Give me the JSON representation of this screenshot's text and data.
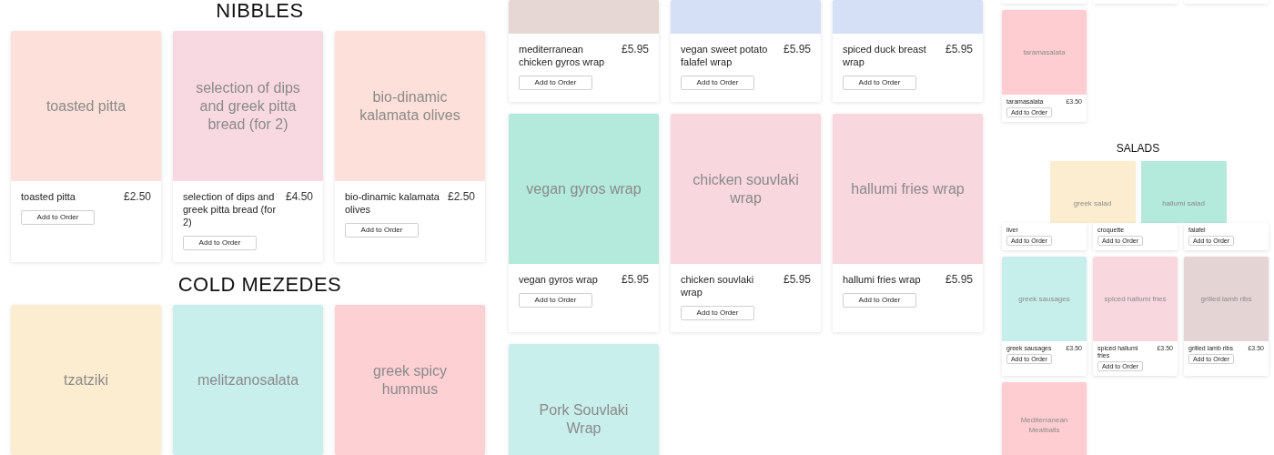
{
  "columns": [
    {
      "blocks": [
        {
          "kind": "heading",
          "text": "NIBBLES"
        },
        {
          "kind": "grid",
          "cards": [
            {
              "kind": "full",
              "color": "#fde0da",
              "image_label": "toasted pitta",
              "name": "toasted pitta",
              "price": "£2.50",
              "button": "Add to Order"
            },
            {
              "kind": "full",
              "color": "#f9d9e1",
              "image_label": "selection of dips and greek pitta bread (for 2)",
              "name": "selection of dips and greek pitta bread (for 2)",
              "price": "£4.50",
              "button": "Add to Order"
            },
            {
              "kind": "full",
              "color": "#fde0da",
              "image_label": "bio-dinamic kalamata olives",
              "name": "bio-dinamic kalamata olives",
              "price": "£2.50",
              "button": "Add to Order"
            }
          ]
        },
        {
          "kind": "heading",
          "text": "COLD MEZEDES"
        },
        {
          "kind": "grid",
          "cards": [
            {
              "kind": "image_only",
              "color": "#fdedd0",
              "image_label": "tzatziki"
            },
            {
              "kind": "image_only",
              "color": "#c8efec",
              "image_label": "melitzanosalata"
            },
            {
              "kind": "image_only",
              "color": "#fdd0d4",
              "image_label": "greek spicy hummus"
            }
          ]
        }
      ]
    },
    {
      "blocks": [
        {
          "kind": "grid",
          "cards": [
            {
              "kind": "cropped_top",
              "color": "#e6d6d4",
              "name": "mediterranean chicken gyros wrap",
              "price": "£5.95",
              "button": "Add to Order"
            },
            {
              "kind": "cropped_top",
              "color": "#d5e0f6",
              "name": "vegan sweet potato falafel wrap",
              "price": "£5.95",
              "button": "Add to Order"
            },
            {
              "kind": "cropped_top",
              "color": "#d5e0f6",
              "name": "spiced duck breast wrap",
              "price": "£5.95",
              "button": "Add to Order"
            }
          ]
        },
        {
          "kind": "grid",
          "cards": [
            {
              "kind": "full",
              "color": "#b4eadb",
              "image_label": "vegan gyros wrap",
              "name": "vegan gyros wrap",
              "price": "£5.95",
              "button": "Add to Order"
            },
            {
              "kind": "full",
              "color": "#f8d7df",
              "image_label": "chicken souvlaki wrap",
              "name": "chicken souvlaki wrap",
              "price": "£5.95",
              "button": "Add to Order"
            },
            {
              "kind": "full",
              "color": "#f8d7df",
              "image_label": "hallumi fries wrap",
              "name": "hallumi fries wrap",
              "price": "£5.95",
              "button": "Add to Order"
            }
          ]
        },
        {
          "kind": "grid",
          "cards": [
            {
              "kind": "image_only",
              "color": "#c8efec",
              "image_label": "Pork Souvlaki Wrap"
            }
          ]
        }
      ]
    },
    {
      "blocks": [
        {
          "kind": "grid",
          "cards": [
            {
              "kind": "stub"
            },
            {
              "kind": "stub"
            },
            {
              "kind": "stub"
            }
          ]
        },
        {
          "kind": "grid",
          "cards": [
            {
              "kind": "full",
              "color": "#fdcdd1",
              "image_label": "taramasalata",
              "name": "taramasalata",
              "price": "£3.50",
              "button": "Add to Order"
            }
          ]
        },
        {
          "kind": "heading",
          "text": "SALADS"
        },
        {
          "kind": "pictures",
          "items": [
            {
              "color": "#fdedd0",
              "image_label": "greek salad"
            },
            {
              "color": "#b4eadb",
              "image_label": "hallumi salad"
            }
          ]
        },
        {
          "kind": "grid",
          "cards": [
            {
              "kind": "covered_top",
              "name": "liver",
              "button": "Add to Order"
            },
            {
              "kind": "covered_top",
              "name": "croquette",
              "button": "Add to Order"
            },
            {
              "kind": "covered_top",
              "name": "falafel",
              "button": "Add to Order"
            }
          ]
        },
        {
          "kind": "grid",
          "cards": [
            {
              "kind": "full",
              "color": "#c6efec",
              "image_label": "greek sausages",
              "name": "greek sausages",
              "price": "£3.50",
              "button": "Add to Order"
            },
            {
              "kind": "full",
              "color": "#f8d7df",
              "image_label": "spiced hallumi fries",
              "name": "spiced hallumi fries",
              "price": "£3.50",
              "button": "Add to Order"
            },
            {
              "kind": "full",
              "color": "#e4d4d3",
              "image_label": "grilled lamb ribs",
              "name": "grilled lamb ribs",
              "price": "£3.50",
              "button": "Add to Order"
            }
          ]
        },
        {
          "kind": "grid",
          "cards": [
            {
              "kind": "image_only",
              "color": "#fdcdd1",
              "image_label": "Mediterranean Meatballs"
            }
          ]
        }
      ]
    }
  ]
}
